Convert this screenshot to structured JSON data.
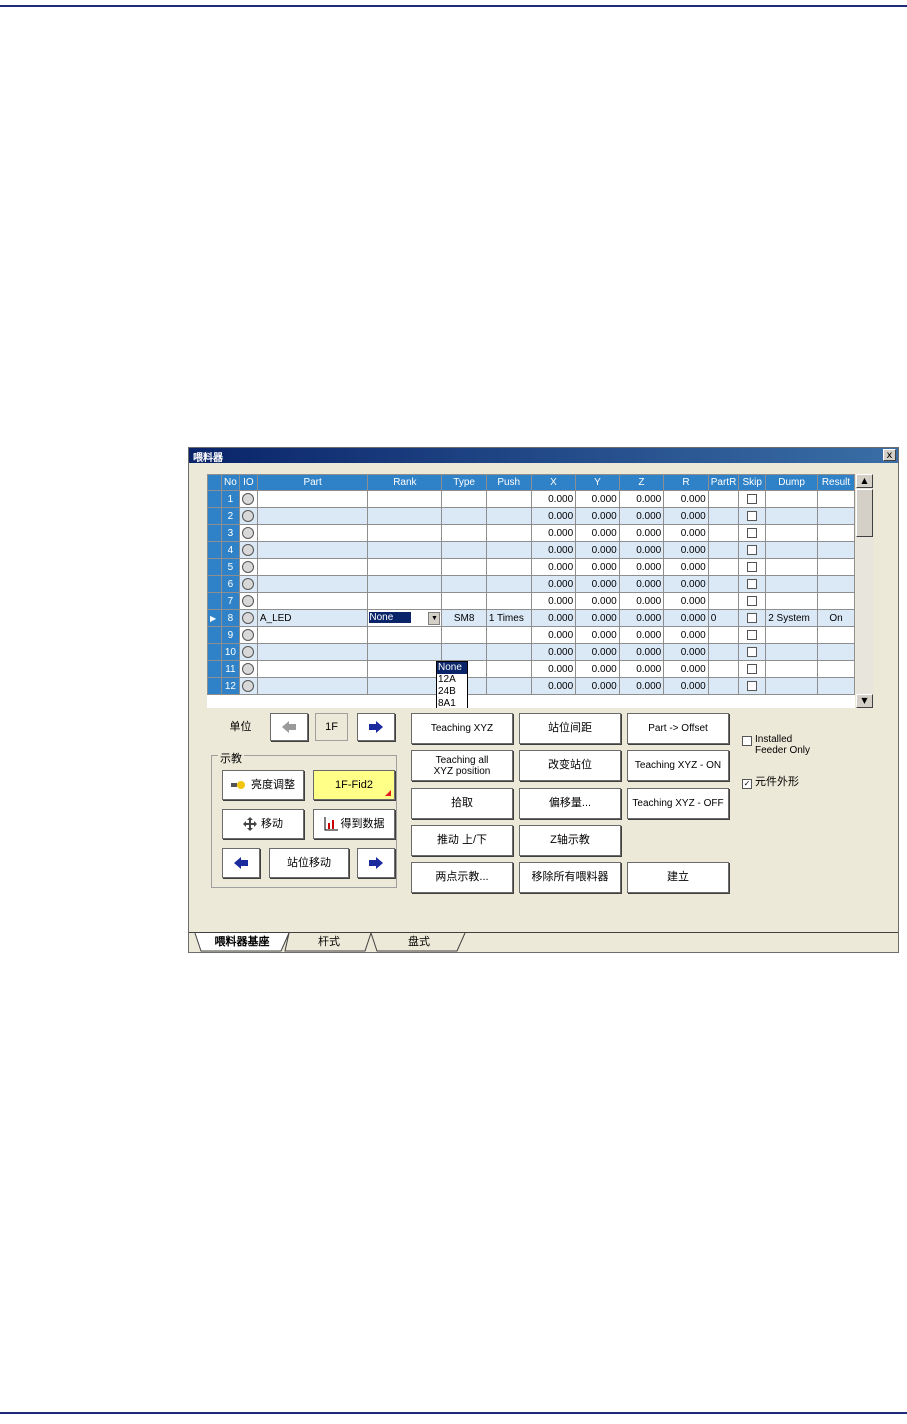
{
  "window": {
    "title": "喂料器",
    "close": "x"
  },
  "grid": {
    "columns": [
      "No",
      "IO",
      "Part",
      "Rank",
      "Type",
      "Push",
      "X",
      "Y",
      "Z",
      "R",
      "PartR",
      "Skip",
      "Dump",
      "Result"
    ],
    "rows": [
      {
        "no": "1",
        "part": "",
        "rank": "",
        "type": "",
        "push": "",
        "x": "0.000",
        "y": "0.000",
        "z": "0.000",
        "r": "0.000",
        "partr": "",
        "dump": "",
        "result": ""
      },
      {
        "no": "2",
        "part": "",
        "rank": "",
        "type": "",
        "push": "",
        "x": "0.000",
        "y": "0.000",
        "z": "0.000",
        "r": "0.000",
        "partr": "",
        "dump": "",
        "result": ""
      },
      {
        "no": "3",
        "part": "",
        "rank": "",
        "type": "",
        "push": "",
        "x": "0.000",
        "y": "0.000",
        "z": "0.000",
        "r": "0.000",
        "partr": "",
        "dump": "",
        "result": ""
      },
      {
        "no": "4",
        "part": "",
        "rank": "",
        "type": "",
        "push": "",
        "x": "0.000",
        "y": "0.000",
        "z": "0.000",
        "r": "0.000",
        "partr": "",
        "dump": "",
        "result": ""
      },
      {
        "no": "5",
        "part": "",
        "rank": "",
        "type": "",
        "push": "",
        "x": "0.000",
        "y": "0.000",
        "z": "0.000",
        "r": "0.000",
        "partr": "",
        "dump": "",
        "result": ""
      },
      {
        "no": "6",
        "part": "",
        "rank": "",
        "type": "",
        "push": "",
        "x": "0.000",
        "y": "0.000",
        "z": "0.000",
        "r": "0.000",
        "partr": "",
        "dump": "",
        "result": ""
      },
      {
        "no": "7",
        "part": "",
        "rank": "",
        "type": "",
        "push": "",
        "x": "0.000",
        "y": "0.000",
        "z": "0.000",
        "r": "0.000",
        "partr": "",
        "dump": "",
        "result": ""
      },
      {
        "no": "8",
        "part": "A_LED",
        "rank": "None",
        "type": "SM8",
        "push": "1 Times",
        "x": "0.000",
        "y": "0.000",
        "z": "0.000",
        "r": "0.000",
        "partr": "0",
        "dump": "2 System",
        "result": "On"
      },
      {
        "no": "9",
        "part": "",
        "rank": "",
        "type": "",
        "push": "",
        "x": "0.000",
        "y": "0.000",
        "z": "0.000",
        "r": "0.000",
        "partr": "",
        "dump": "",
        "result": ""
      },
      {
        "no": "10",
        "part": "",
        "rank": "",
        "type": "",
        "push": "",
        "x": "0.000",
        "y": "0.000",
        "z": "0.000",
        "r": "0.000",
        "partr": "",
        "dump": "",
        "result": ""
      },
      {
        "no": "11",
        "part": "",
        "rank": "",
        "type": "",
        "push": "",
        "x": "0.000",
        "y": "0.000",
        "z": "0.000",
        "r": "0.000",
        "partr": "",
        "dump": "",
        "result": ""
      },
      {
        "no": "12",
        "part": "",
        "rank": "",
        "type": "",
        "push": "",
        "x": "0.000",
        "y": "0.000",
        "z": "0.000",
        "r": "0.000",
        "partr": "",
        "dump": "",
        "result": ""
      }
    ],
    "selected_row": 8,
    "rank_dropdown_options": [
      "None",
      "12A",
      "24B",
      "8A1"
    ]
  },
  "nav": {
    "unit_label": "单位",
    "floor": "1F"
  },
  "teach_group": {
    "label": "示教",
    "brightness": "亮度调整",
    "fid": "1F-Fid2",
    "move": "移动",
    "get_data": "得到数据",
    "station_move": "站位移动"
  },
  "buttons": {
    "teaching_xyz": "Teaching XYZ",
    "station_pitch": "站位间距",
    "part_offset": "Part -> Offset",
    "teaching_all": "Teaching all XYZ position",
    "change_station": "改变站位",
    "teaching_on": "Teaching XYZ - ON",
    "pickup": "拾取",
    "offset": "偏移量...",
    "teaching_off": "Teaching XYZ - OFF",
    "push_updown": "推动 上/下",
    "z_teach": "Z轴示教",
    "two_point": "两点示教...",
    "remove_all": "移除所有喂料器",
    "create": "建立"
  },
  "options": {
    "installed_feeder_only": "Installed Feeder Only",
    "part_outline": "元件外形",
    "part_outline_checked": true,
    "installed_checked": false
  },
  "tabs": [
    "喂料器基座",
    "杆式",
    "盘式"
  ],
  "colors": {
    "header": "#2f82c7",
    "alt_row": "#dbe9f7",
    "fid_button": "#ffff88",
    "arrow": "#1b2b9e"
  }
}
